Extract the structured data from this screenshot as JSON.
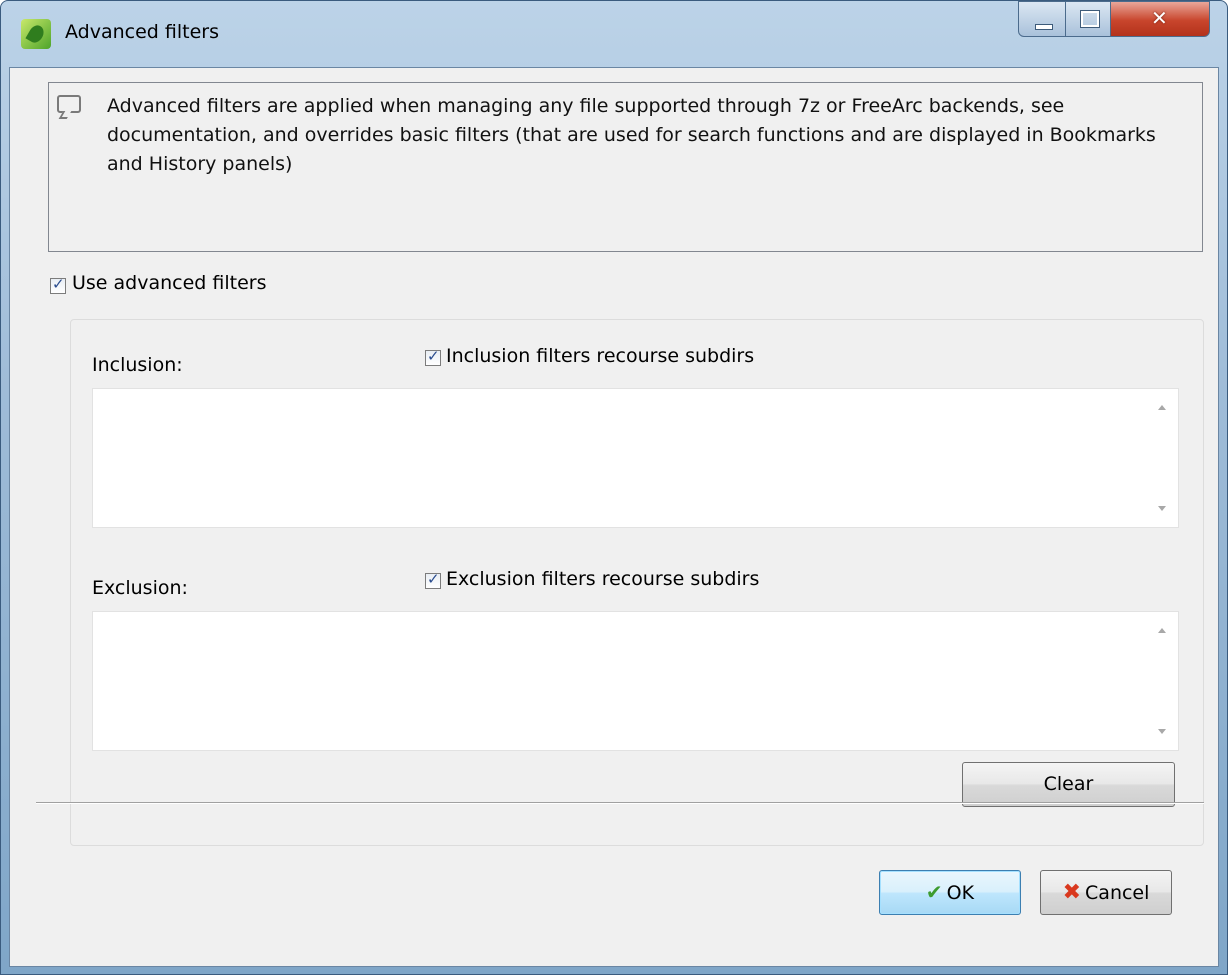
{
  "window": {
    "title": "Advanced filters"
  },
  "info": {
    "text": "Advanced filters are applied when managing any file supported through 7z or FreeArc backends, see documentation, and overrides basic filters (that are used for search functions and are displayed in Bookmarks and History panels)"
  },
  "use_advanced": {
    "label": "Use advanced filters",
    "checked": true
  },
  "inclusion": {
    "label": "Inclusion:",
    "recourse_label": "Inclusion filters recourse subdirs",
    "recourse_checked": true,
    "value": ""
  },
  "exclusion": {
    "label": "Exclusion:",
    "recourse_label": "Exclusion filters recourse subdirs",
    "recourse_checked": true,
    "value": ""
  },
  "buttons": {
    "clear": "Clear",
    "ok": "OK",
    "cancel": "Cancel"
  },
  "icons": {
    "app": "green-leaf-icon",
    "info": "speech-bubble-icon",
    "ok": "checkmark-icon",
    "cancel": "red-x-icon"
  }
}
